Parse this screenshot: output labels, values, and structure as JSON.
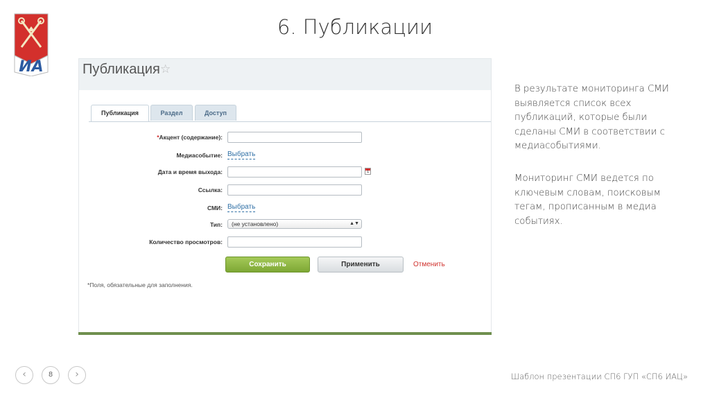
{
  "slide": {
    "title": "6. Публикации",
    "page_number": "8",
    "footer": "Шаблон презентации СП6 ГУП «СП6 ИАЦ»",
    "logo_colors": {
      "shield_red": "#d3302c",
      "letters_blue": "#2c5aa0"
    }
  },
  "screenshot": {
    "header_title": "Публикация",
    "tabs": [
      {
        "label": "Публикация",
        "active": true
      },
      {
        "label": "Раздел",
        "active": false
      },
      {
        "label": "Доступ",
        "active": false
      }
    ],
    "form": {
      "accent": {
        "required_mark": "*",
        "label": "Акцент (содержание):",
        "value": ""
      },
      "media_event": {
        "label": "Медиасобытие:",
        "link": "Выбрать"
      },
      "datetime": {
        "label": "Дата и время выхода:",
        "value": ""
      },
      "url": {
        "label": "Ссылка:",
        "value": ""
      },
      "smi": {
        "label": "СМИ:",
        "link": "Выбрать"
      },
      "type": {
        "label": "Тип:",
        "selected": "(не установлено)"
      },
      "views": {
        "label": "Количество просмотров:",
        "value": ""
      }
    },
    "buttons": {
      "save": "Сохранить",
      "apply": "Применить",
      "cancel": "Отменить"
    },
    "footnote": "*Поля, обязательные для заполнения."
  },
  "description": {
    "paragraph1": "В результате мониторинга СМИ выявляется список всех публикаций, которые были сделаны СМИ в соответствии с медиасобытиями.",
    "paragraph2": "Мониторинг СМИ ведется по ключевым словам, поисковым тегам, прописанным в медиа событиях."
  }
}
